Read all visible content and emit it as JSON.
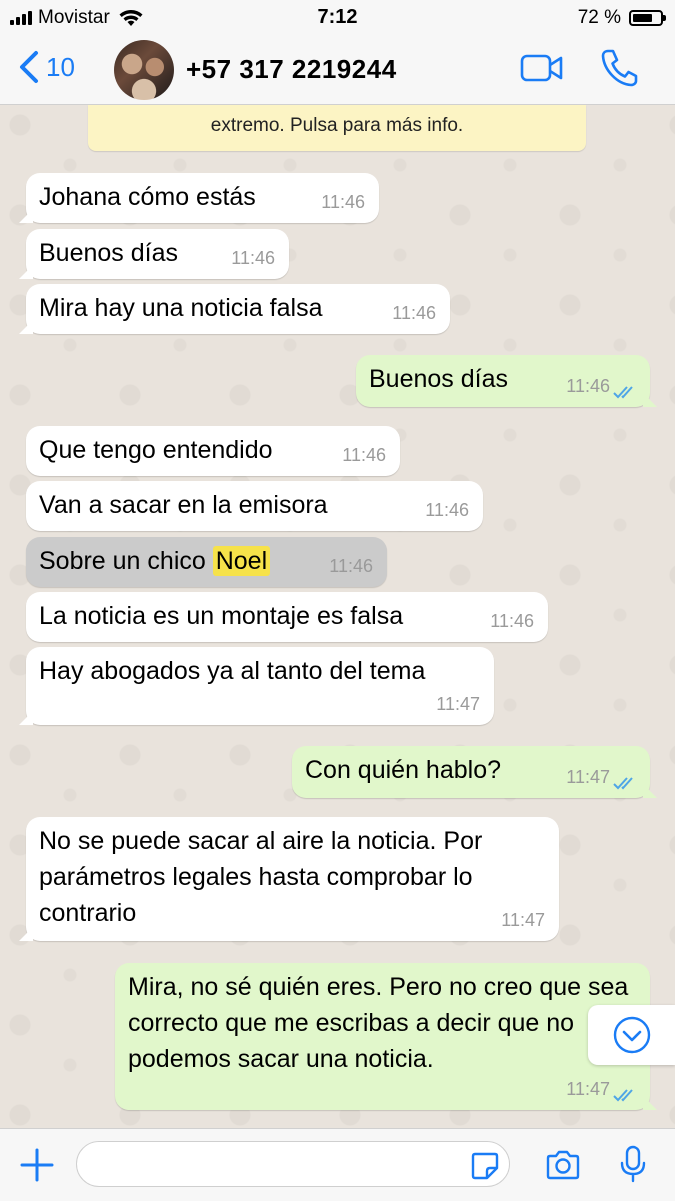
{
  "status_bar": {
    "carrier": "Movistar",
    "time": "7:12",
    "battery": "72 %",
    "battery_level": 0.72
  },
  "header": {
    "back_count": "10",
    "contact_name": "+57 317 2219244"
  },
  "encryption_notice": "extremo. Pulsa para más info.",
  "messages": [
    {
      "dir": "in",
      "text": "Johana cómo estás",
      "time": "11:46"
    },
    {
      "dir": "in",
      "text": "Buenos días",
      "time": "11:46"
    },
    {
      "dir": "in",
      "text": "Mira hay una noticia falsa",
      "time": "11:46"
    },
    {
      "dir": "out",
      "text": "Buenos días",
      "time": "11:46"
    },
    {
      "dir": "in",
      "text": "Que tengo entendido",
      "time": "11:46"
    },
    {
      "dir": "in",
      "text": "Van a sacar en la emisora",
      "time": "11:46"
    },
    {
      "dir": "in",
      "text_before": "Sobre un chico ",
      "highlight": "Noel",
      "time": "11:46"
    },
    {
      "dir": "in",
      "text": "La noticia es un montaje es falsa",
      "time": "11:46"
    },
    {
      "dir": "in",
      "text": "Hay abogados ya al tanto del tema",
      "time": "11:47"
    },
    {
      "dir": "out",
      "text": "Con quién hablo?",
      "time": "11:47"
    },
    {
      "dir": "in",
      "text": "No se puede sacar al aire la noticia. Por parámetros legales hasta comprobar lo contrario",
      "time": "11:47"
    },
    {
      "dir": "out",
      "text": "Mira, no sé quién eres. Pero no creo que sea correcto que me escribas a decir que no podemos sacar una noticia.",
      "time": "11:47"
    }
  ],
  "colors": {
    "accent": "#1a7cf5",
    "incoming_bubble": "#ffffff",
    "outgoing_bubble": "#e1f7cb",
    "highlight": "#f6e24a",
    "read_ticks": "#4fa5e6"
  }
}
